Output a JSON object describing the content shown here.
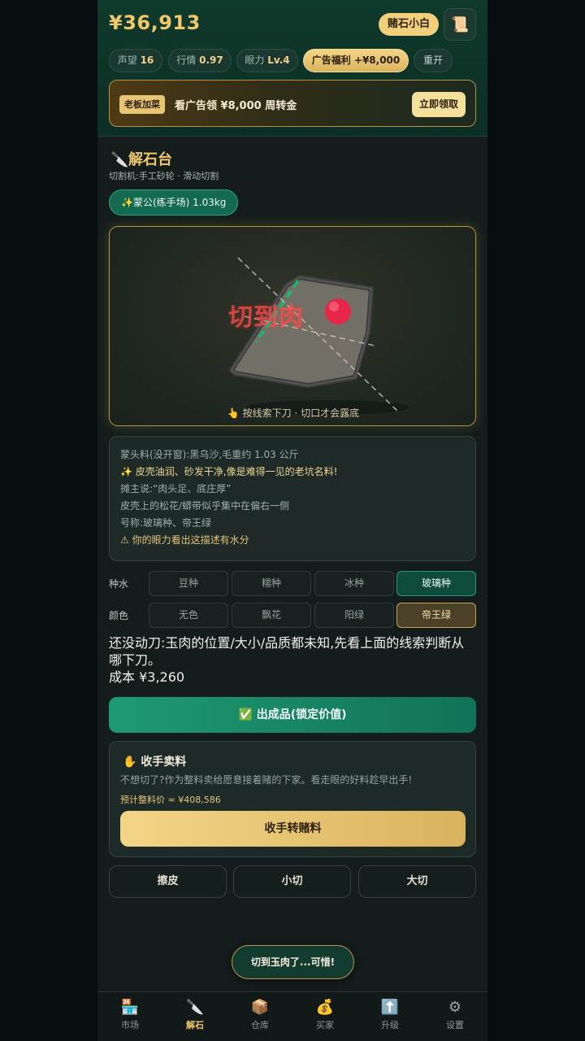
{
  "header": {
    "money": "¥36,913",
    "title_badge": "赌石小白",
    "scroll_icon": "📜",
    "stats": [
      {
        "label": "声望",
        "value": "16"
      },
      {
        "label": "行情",
        "value": "0.97"
      },
      {
        "label": "眼力",
        "value": "Lv.4"
      }
    ],
    "ad_chip": "广告福利 +¥8,000",
    "reset_label": "重开"
  },
  "banner": {
    "tag": "老板加菜",
    "text": "看广告领 ¥8,000 周转金",
    "button": "立即领取"
  },
  "section": {
    "icon": "🔪",
    "title": "解石台",
    "subtitle": "切割机:手工砂轮 · 滑动切割",
    "stone_chip": "✨蒙公(练手场) 1.03kg"
  },
  "stage": {
    "cut_text": "切到肉",
    "hint": "👆 按线索下刀 · 切口才会露底"
  },
  "description": {
    "lines": [
      "蒙头料(没开窗):黑乌沙,毛重约 1.03 公斤",
      "✨ 皮壳油润、砂发干净,像是难得一见的老坑名料!",
      "摊主说:“肉头足、底庄厚”",
      "皮壳上的松花/蟒带似乎集中在偏右一侧",
      "号称:玻璃种、帝王绿",
      "⚠ 你的眼力看出这描述有水分"
    ]
  },
  "options": {
    "kind_label": "种水",
    "kind": [
      "豆种",
      "糯种",
      "冰种",
      "玻璃种"
    ],
    "kind_selected": "玻璃种",
    "color_label": "颜色",
    "color": [
      "无色",
      "飘花",
      "阳绿",
      "帝王绿"
    ],
    "color_selected": "帝王绿"
  },
  "status": {
    "text": "还没动刀:玉肉的位置/大小/品质都未知,先看上面的线索判断从哪下刀。",
    "cost": "成本 ¥3,260"
  },
  "lock_button": "✅ 出成品(锁定价值)",
  "sell": {
    "icon": "✋",
    "title": "收手卖料",
    "desc": "不想切了?作为整料卖给愿意接着赌的下家。看走眼的好料趁早出手!",
    "estimate": "预计整料价 ≈ ¥408,586",
    "button": "收手转赌料"
  },
  "cut_actions": [
    "擦皮",
    "小切",
    "大切"
  ],
  "toast": "切到玉肉了...可惜!",
  "tabs": [
    {
      "icon": "🏪",
      "label": "市场"
    },
    {
      "icon": "🔪",
      "label": "解石"
    },
    {
      "icon": "📦",
      "label": "仓库"
    },
    {
      "icon": "💰",
      "label": "买家"
    },
    {
      "icon": "⬆️",
      "label": "升级"
    },
    {
      "icon": "⚙",
      "label": "设置"
    }
  ],
  "active_tab": "解石",
  "colors": {
    "gold": "#f0c86a",
    "green_accent": "#1e9a73",
    "jade_red": "#ff4a4a"
  }
}
